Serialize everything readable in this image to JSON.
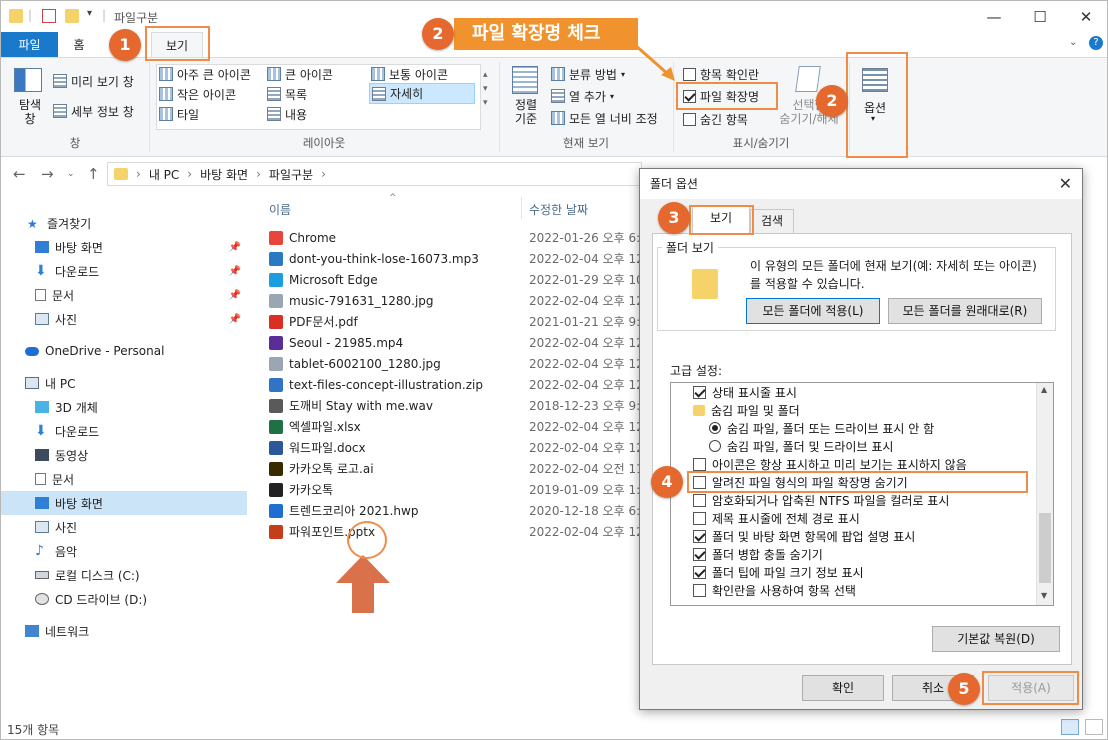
{
  "window": {
    "title": "파일구분",
    "minimize": "—",
    "maximize": "☐",
    "close": "✕"
  },
  "menu_tabs": {
    "file": "파일",
    "home": "홈",
    "view": "보기"
  },
  "callout_text": "파일 확장명 체크",
  "ribbon": {
    "pane_group": {
      "nav_pane": "탐색\n창",
      "preview": "미리 보기 창",
      "details": "세부 정보 창",
      "label": "창"
    },
    "layout_group": {
      "items": [
        "아주 큰 아이콘",
        "큰 아이콘",
        "보통 아이콘",
        "작은 아이콘",
        "목록",
        "자세히",
        "타일",
        "내용"
      ],
      "selected": "자세히",
      "label": "레이아웃"
    },
    "current_view_group": {
      "sort": "정렬\n기준",
      "group_by": "분류 방법",
      "add_column": "열 추가",
      "fit_columns": "모든 열 너비 조정",
      "label": "현재 보기"
    },
    "show_hide_group": {
      "item_checkboxes": "항목 확인란",
      "file_extensions": "파일 확장명",
      "hidden_items": "숨긴 항목",
      "hide_selected": "선택한\n숨기기/해제",
      "label": "표시/숨기기"
    },
    "options": "옵션"
  },
  "address": {
    "path": [
      "내 PC",
      "바탕 화면",
      "파일구분"
    ]
  },
  "nav_pane": {
    "quick_access": "즐겨찾기",
    "quick_items": [
      "바탕 화면",
      "다운로드",
      "문서",
      "사진"
    ],
    "onedrive": "OneDrive - Personal",
    "this_pc": "내 PC",
    "pc_items": [
      "3D 개체",
      "다운로드",
      "동영상",
      "문서",
      "바탕 화면",
      "사진",
      "음악",
      "로컬 디스크 (C:)",
      "CD 드라이브 (D:)"
    ],
    "network": "네트워크",
    "selected": "바탕 화면"
  },
  "file_list": {
    "col_name": "이름",
    "col_date": "수정한 날짜",
    "files": [
      {
        "name": "Chrome",
        "date": "2022-01-26 오후 6:0",
        "color": "#e8453c"
      },
      {
        "name": "dont-you-think-lose-16073.mp3",
        "date": "2022-02-04 오후 12",
        "color": "#2b78c5"
      },
      {
        "name": "Microsoft Edge",
        "date": "2022-01-29 오후 10",
        "color": "#1b9de2"
      },
      {
        "name": "music-791631_1280.jpg",
        "date": "2022-02-04 오후 12",
        "color": "#9aa6b2"
      },
      {
        "name": "PDF문서.pdf",
        "date": "2021-01-21 오후 9:1",
        "color": "#d93025"
      },
      {
        "name": "Seoul - 21985.mp4",
        "date": "2022-02-04 오후 12",
        "color": "#5b2d9b"
      },
      {
        "name": "tablet-6002100_1280.jpg",
        "date": "2022-02-04 오후 12",
        "color": "#9aa6b2"
      },
      {
        "name": "text-files-concept-illustration.zip",
        "date": "2022-02-04 오후 12",
        "color": "#3174c6"
      },
      {
        "name": "도깨비 Stay with me.wav",
        "date": "2018-12-23 오후 9:3",
        "color": "#5a5a5a"
      },
      {
        "name": "엑셀파일.xlsx",
        "date": "2022-02-04 오후 12",
        "color": "#1e7145"
      },
      {
        "name": "워드파일.docx",
        "date": "2022-02-04 오후 12",
        "color": "#2b579a"
      },
      {
        "name": "카카오톡 로고.ai",
        "date": "2022-02-04 오전 11",
        "color": "#3a2a00"
      },
      {
        "name": "카카오톡",
        "date": "2019-01-09 오후 1:2",
        "color": "#222222"
      },
      {
        "name": "트렌드코리아 2021.hwp",
        "date": "2020-12-18 오후 6:",
        "color": "#1f6fd1"
      },
      {
        "name": "파워포인트.pptx",
        "date": "2022-02-04 오후 12",
        "color": "#c43e1c"
      }
    ]
  },
  "status": {
    "count": "15개 항목"
  },
  "dialog": {
    "title": "폴더 옵션",
    "close": "✕",
    "tabs": [
      "보기",
      "검색"
    ],
    "folder_view_legend": "폴더 보기",
    "folder_view_text": "이 유형의 모든 폴더에 현재 보기(예: 자세히 또는 아이콘)를 적용할 수 있습니다.",
    "apply_all": "모든 폴더에 적용(L)",
    "reset_all": "모든 폴더를 원래대로(R)",
    "advanced_label": "고급 설정:",
    "settings": [
      {
        "label": "상태 표시줄 표시",
        "type": "check",
        "checked": true
      },
      {
        "label": "숨김 파일 및 폴더",
        "type": "folder",
        "checked": false
      },
      {
        "label": "숨김 파일, 폴더 또는 드라이브 표시 안 함",
        "type": "radio",
        "checked": true
      },
      {
        "label": "숨김 파일, 폴더 및 드라이브 표시",
        "type": "radio",
        "checked": false
      },
      {
        "label": "아이콘은 항상 표시하고 미리 보기는 표시하지 않음",
        "type": "check",
        "checked": false
      },
      {
        "label": "알려진 파일 형식의 파일 확장명 숨기기",
        "type": "check",
        "checked": false
      },
      {
        "label": "암호화되거나 압축된 NTFS 파일을 컬러로 표시",
        "type": "check",
        "checked": false
      },
      {
        "label": "제목 표시줄에 전체 경로 표시",
        "type": "check",
        "checked": false
      },
      {
        "label": "폴더 및 바탕 화면 항목에 팝업 설명 표시",
        "type": "check",
        "checked": true
      },
      {
        "label": "폴더 병합 충돌 숨기기",
        "type": "check",
        "checked": true
      },
      {
        "label": "폴더 팁에 파일 크기 정보 표시",
        "type": "check",
        "checked": true
      },
      {
        "label": "확인란을 사용하여 항목 선택",
        "type": "check",
        "checked": false
      }
    ],
    "restore_defaults": "기본값 복원(D)",
    "ok": "확인",
    "cancel": "취소",
    "apply": "적용(A)"
  },
  "steps": [
    "1",
    "2",
    "2",
    "3",
    "4",
    "5"
  ],
  "colors": {
    "accent_orange": "#e5682e",
    "ribbon_bg": "#f5f6f7",
    "file_tab_blue": "#1979ca",
    "selection_blue": "#cce4f7"
  }
}
